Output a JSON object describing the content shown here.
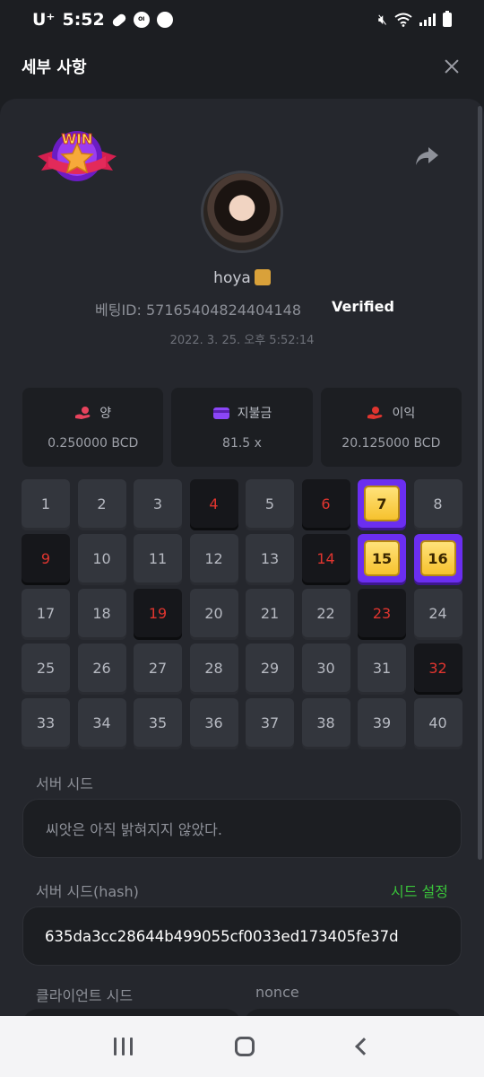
{
  "status_bar": {
    "carrier": "U⁺",
    "time": "5:52",
    "icons": [
      "pill-icon",
      "oi-lock-icon",
      "chat-bubble-icon",
      "mute-icon",
      "wifi-icon",
      "signal-icon",
      "battery-icon"
    ]
  },
  "header": {
    "title": "세부 사항"
  },
  "bet": {
    "username": "hoya",
    "bet_id": "베팅ID: 571654048244041​48",
    "verified": "Verified",
    "datetime": "2022. 3. 25. 오후 5:52:14"
  },
  "stats": [
    {
      "label": "양",
      "value": "0.250000 BCD",
      "icon": "coins-hand-icon",
      "color": "#e8435d"
    },
    {
      "label": "지불금",
      "value": "81.5 x",
      "icon": "wallet-icon",
      "color": "#8b46f7"
    },
    {
      "label": "이익",
      "value": "20.125000 BCD",
      "icon": "profit-hand-icon",
      "color": "#e0352f"
    }
  ],
  "keno": {
    "numbers": [
      "1",
      "2",
      "3",
      "4",
      "5",
      "6",
      "7",
      "8",
      "9",
      "10",
      "11",
      "12",
      "13",
      "14",
      "15",
      "16",
      "17",
      "18",
      "19",
      "20",
      "21",
      "22",
      "23",
      "24",
      "25",
      "26",
      "27",
      "28",
      "29",
      "30",
      "31",
      "32",
      "33",
      "34",
      "35",
      "36",
      "37",
      "38",
      "39",
      "40"
    ],
    "drawn": [
      4,
      6,
      9,
      14,
      19,
      23,
      32
    ],
    "hits": [
      7,
      15,
      16
    ]
  },
  "seeds": {
    "server_seed_label": "서버 시드",
    "server_seed_value": "씨앗은 아직 밝혀지지 않았다.",
    "server_hash_label": "서버 시드(hash)",
    "set_seed_link": "시드 설정",
    "server_hash_value": "635da3cc28644b499055cf0033ed173405fe37d",
    "client_seed_label": "클라이언트 시드",
    "nonce_label": "nonce"
  },
  "colors": {
    "accent_green": "#3ac43a",
    "drawn_red": "#e0352f",
    "hit_purple": "#6b2ef0",
    "hit_gold": "#f6c22e"
  },
  "nav": [
    "recent-apps-icon",
    "home-icon",
    "back-icon"
  ]
}
